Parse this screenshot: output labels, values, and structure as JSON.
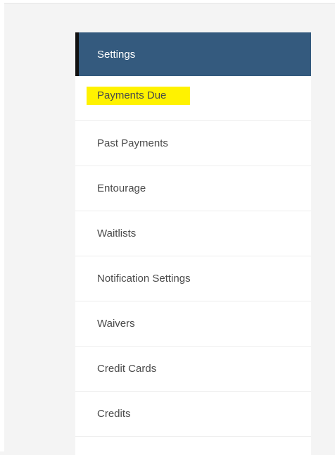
{
  "menu": {
    "header": "Settings",
    "items": [
      {
        "label": "Payments Due",
        "highlighted": true
      },
      {
        "label": "Past Payments",
        "highlighted": false
      },
      {
        "label": "Entourage",
        "highlighted": false
      },
      {
        "label": "Waitlists",
        "highlighted": false
      },
      {
        "label": "Notification Settings",
        "highlighted": false
      },
      {
        "label": "Waivers",
        "highlighted": false
      },
      {
        "label": "Credit Cards",
        "highlighted": false
      },
      {
        "label": "Credits",
        "highlighted": false
      }
    ]
  },
  "colors": {
    "header_bg": "#345a7e",
    "header_accent_bar": "#111111",
    "highlight": "#fff200",
    "item_text": "#4a4a4a",
    "page_bg": "#f4f4f4"
  }
}
